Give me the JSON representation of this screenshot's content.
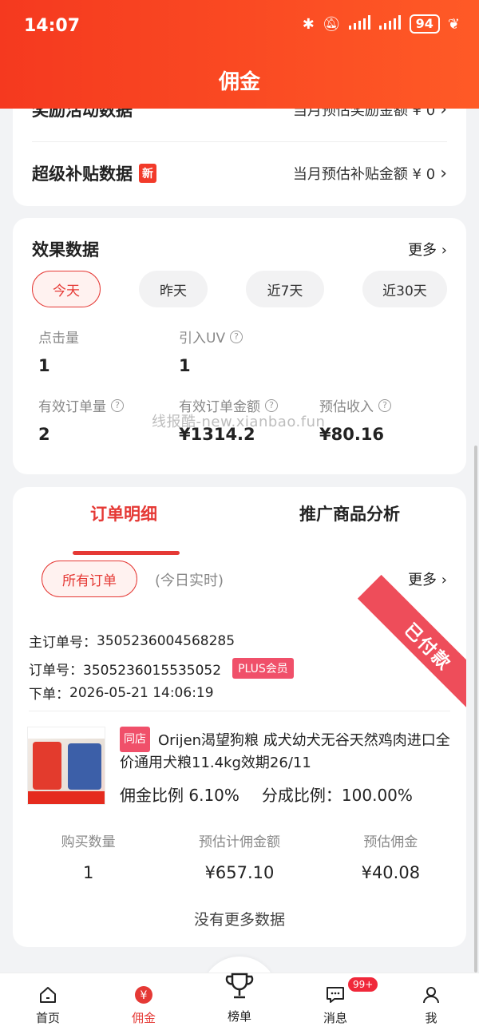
{
  "status_bar": {
    "time": "14:07",
    "battery": "94"
  },
  "header": {
    "title": "佣金"
  },
  "top_card": {
    "row1": {
      "title": "奖励活动数据",
      "right": "当月预估奖励金额 ¥ 0"
    },
    "row2": {
      "title": "超级补贴数据",
      "badge": "新",
      "right": "当月预估补贴金额 ¥ 0"
    }
  },
  "effect": {
    "title": "效果数据",
    "more": "更多",
    "periods": [
      "今天",
      "昨天",
      "近7天",
      "近30天"
    ],
    "metrics": {
      "clicks": {
        "label": "点击量",
        "value": "1"
      },
      "uv": {
        "label": "引入UV",
        "value": "1"
      },
      "orders": {
        "label": "有效订单量",
        "value": "2"
      },
      "amount": {
        "label": "有效订单金额",
        "value": "¥1314.2"
      },
      "income": {
        "label": "预估收入",
        "value": "¥80.16"
      }
    },
    "watermark": "线报酷-new.xianbao.fun"
  },
  "orders": {
    "tabs": [
      "订单明细",
      "推广商品分析"
    ],
    "filter": "所有订单",
    "realtime": "(今日实时)",
    "more": "更多",
    "status": "已付款",
    "main_order_label": "主订单号：",
    "main_order_no": "3505236004568285",
    "order_label": "订单号：",
    "order_no": "3505236015535052",
    "member_badge": "PLUS会员",
    "date_label": "下单：",
    "date": "2026-05-21 14:06:19",
    "product": {
      "store_badge": "同店",
      "name": "Orijen渴望狗粮 成犬幼犬无谷天然鸡肉进口全价通用犬粮11.4kg效期26/11",
      "commission_ratio_label": "佣金比例",
      "commission_ratio": "6.10%",
      "share_ratio_label": "分成比例：",
      "share_ratio": "100.00%"
    },
    "stats": [
      {
        "label": "购买数量",
        "value": "1"
      },
      {
        "label": "预估计佣金额",
        "value": "¥657.10"
      },
      {
        "label": "预估佣金",
        "value": "¥40.08"
      }
    ],
    "no_more": "没有更多数据"
  },
  "nav": {
    "items": [
      "首页",
      "佣金",
      "榜单",
      "消息",
      "我"
    ],
    "message_badge": "99+"
  },
  "colors": {
    "accent": "#e53935",
    "header_start": "#f5391f",
    "header_end": "#ff5a26"
  }
}
